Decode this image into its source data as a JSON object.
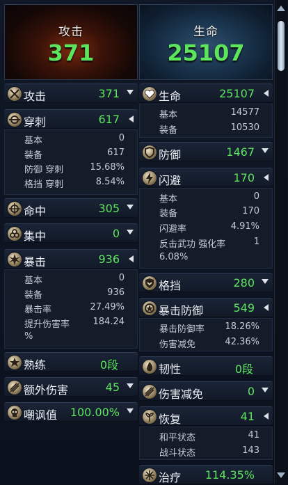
{
  "hero": {
    "attack": {
      "title": "攻击",
      "value": "371"
    },
    "health": {
      "title": "生命",
      "value": "25107"
    }
  },
  "left": {
    "attack": {
      "label": "攻击",
      "value": "371"
    },
    "pierce": {
      "label": "穿刺",
      "value": "617",
      "details": [
        {
          "k": "基本",
          "v": "0"
        },
        {
          "k": "装备",
          "v": "617"
        },
        {
          "k": "防御 穿刺",
          "v": "15.68%"
        },
        {
          "k": "格挡 穿刺",
          "v": "8.54%"
        }
      ]
    },
    "accuracy": {
      "label": "命中",
      "value": "305"
    },
    "focus": {
      "label": "集中",
      "value": "0"
    },
    "critical": {
      "label": "暴击",
      "value": "936",
      "details": [
        {
          "k": "基本",
          "v": "0"
        },
        {
          "k": "装备",
          "v": "936"
        },
        {
          "k": "暴击率",
          "v": "27.49%"
        },
        {
          "k": "提升伤害率",
          "v": "184.24"
        },
        {
          "k": "%",
          "v": ""
        }
      ]
    },
    "mastery": {
      "label": "熟练",
      "value": "0段"
    },
    "extra_damage": {
      "label": "额外伤害",
      "value": "45"
    },
    "threat": {
      "label": "嘲讽值",
      "value": "100.00%"
    }
  },
  "right": {
    "health": {
      "label": "生命",
      "value": "25107",
      "details": [
        {
          "k": "基本",
          "v": "14577"
        },
        {
          "k": "装备",
          "v": "10530"
        }
      ]
    },
    "defense": {
      "label": "防御",
      "value": "1467"
    },
    "evasion": {
      "label": "闪避",
      "value": "170",
      "details": [
        {
          "k": "基本",
          "v": "0"
        },
        {
          "k": "装备",
          "v": "170"
        },
        {
          "k": "闪避率",
          "v": "4.91%"
        },
        {
          "k": "反击武功 强化率",
          "v": "1"
        },
        {
          "k": "6.08%",
          "v": ""
        }
      ]
    },
    "block": {
      "label": "格挡",
      "value": "280"
    },
    "crit_defense": {
      "label": "暴击防御",
      "value": "549",
      "details": [
        {
          "k": "暴击防御率",
          "v": "18.26%"
        },
        {
          "k": "伤害减免",
          "v": "42.36%"
        }
      ]
    },
    "toughness": {
      "label": "韧性",
      "value": "0段"
    },
    "damage_reduction": {
      "label": "伤害减免",
      "value": "0"
    },
    "recovery": {
      "label": "恢复",
      "value": "41",
      "details": [
        {
          "k": "和平状态",
          "v": "41"
        },
        {
          "k": "战斗状态",
          "v": "143"
        }
      ]
    },
    "healing": {
      "label": "治疗",
      "value": "114.35%"
    }
  },
  "colors": {
    "value_green": "#5ee55e",
    "label_white": "#eef2f7",
    "detail_grey": "#c7ccd4"
  }
}
